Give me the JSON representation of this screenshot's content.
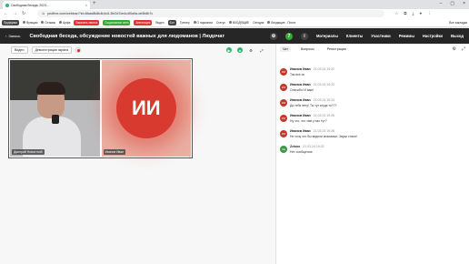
{
  "browser": {
    "tab_title": "Свободная беседа, 2023...",
    "url": "pruffme.com/webinar/?id=8fcad8b8b4b4c5-3fe2d7de4c4f0a9a-de5b8b7c",
    "bookmarks": [
      "Пруффми",
      "Функции",
      "Отзывы",
      "Арфа",
      "Заказать звонок",
      "Социальные сети",
      "Аннотация",
      "Видео",
      "Бот",
      "Тренер",
      "О гармонии",
      "Статус",
      "ВХОДЯЩИЕ",
      "Сегодня",
      "Входящие - Почта",
      "Все закладки"
    ]
  },
  "app": {
    "back_label": "Запись",
    "title": "Свободная беседа, обсуждение новостей важных для людоманов | Людочат",
    "nav": [
      "Материалы",
      "Клиенты",
      "Участники",
      "Режимы",
      "Настройки",
      "Выход"
    ],
    "participants_count": "7"
  },
  "stage": {
    "view_label": "Видео",
    "demo_label": "Демонстрация экрана",
    "participants": [
      {
        "name": "Дмитрий Новостной",
        "type": "video"
      },
      {
        "name": "Иванов Иван",
        "type": "avatar",
        "initials": "ИИ"
      }
    ]
  },
  "side": {
    "tabs": [
      "Чат",
      "Вопросы",
      "Регистрация"
    ],
    "messages": [
      {
        "initials": "ИИ",
        "author": "Иванов Иван",
        "time": "21.03.24 19:22",
        "text": "Так все ок",
        "color": "#c0392b"
      },
      {
        "initials": "ИИ",
        "author": "Иванов Иван",
        "time": "21.03.24 19:23",
        "text": "Спасибо! И вам!",
        "color": "#c0392b"
      },
      {
        "initials": "ИИ",
        "author": "Иванов Иван",
        "time": "21.03.24 19:24",
        "text": "Да тебя нету! Ты тут когда то???",
        "color": "#c0392b"
      },
      {
        "initials": "ИИ",
        "author": "Иванов Иван",
        "time": "21.03.24 19:26",
        "text": "Ну что, что там у нас тут?",
        "color": "#c0392b"
      },
      {
        "initials": "ИИ",
        "author": "Иванов Иван",
        "time": "21.03.24 19:28",
        "text": "Не хочу что бы видели знакомые. Звуки стали!",
        "color": "#c0392b"
      },
      {
        "initials": "ZE",
        "author": "Zzlooo",
        "time": "21.03.24 19:32",
        "text": "Нет сообщения",
        "color": "#3a9a47"
      }
    ]
  }
}
